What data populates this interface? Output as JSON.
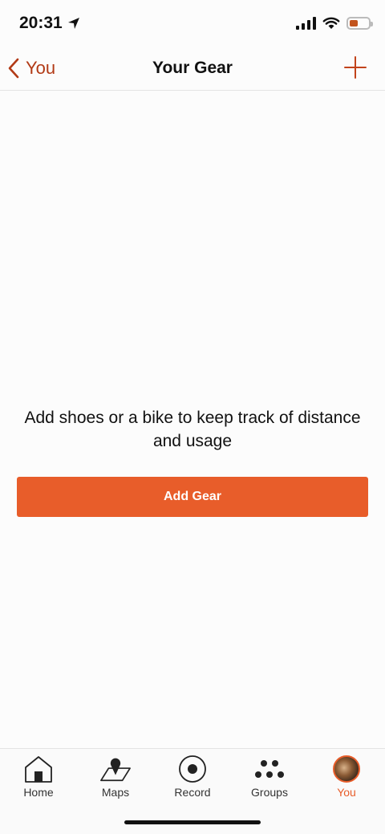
{
  "status_bar": {
    "time": "20:31",
    "battery_level": 0.45,
    "battery_color": "#c2531c"
  },
  "nav": {
    "back_label": "You",
    "title": "Your Gear",
    "add_icon": "plus-icon"
  },
  "content": {
    "empty_message": "Add shoes or a bike to keep track of distance and usage",
    "add_button_label": "Add Gear"
  },
  "tabs": [
    {
      "label": "Home",
      "icon": "home-icon",
      "active": false
    },
    {
      "label": "Maps",
      "icon": "map-icon",
      "active": false
    },
    {
      "label": "Record",
      "icon": "record-icon",
      "active": false
    },
    {
      "label": "Groups",
      "icon": "groups-icon",
      "active": false
    },
    {
      "label": "You",
      "icon": "avatar",
      "active": true
    }
  ],
  "colors": {
    "accent": "#e85d2a",
    "back_link": "#b23a16"
  }
}
